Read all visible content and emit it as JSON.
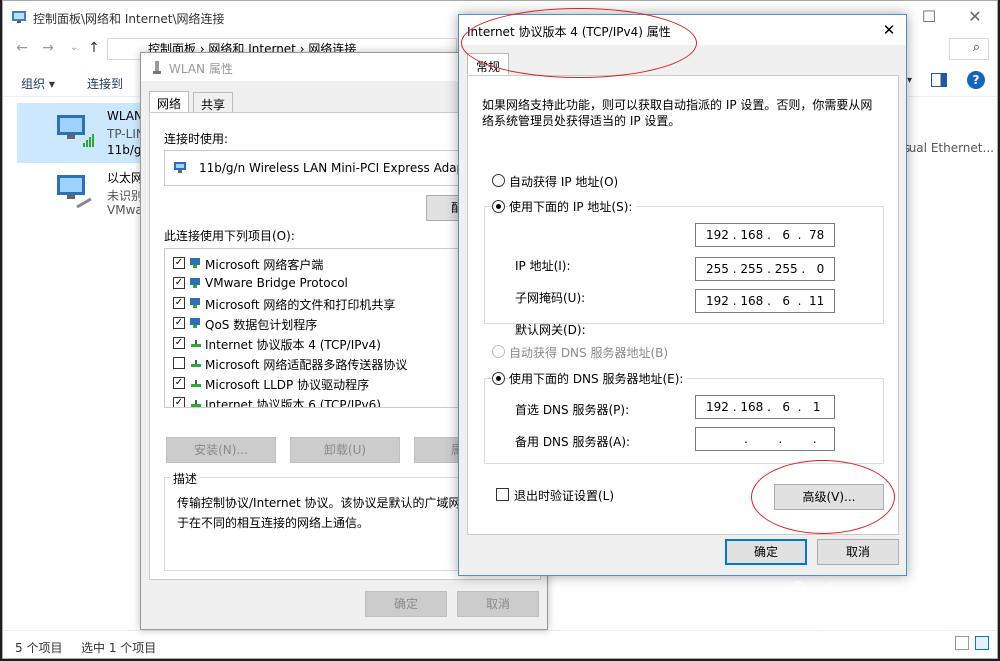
{
  "explorer": {
    "title": "控制面板\\网络和 Internet\\网络连接",
    "address": "控制面板 › 网络和 Internet › 网络连接",
    "toolbar": {
      "organize": "组织 ▾",
      "connect_to": "连接到"
    },
    "entries": [
      {
        "name": "WLAN",
        "line2": "TP-LIN",
        "line3": "11b/g/",
        "selected": true
      },
      {
        "name": "以太网",
        "line2": "未识别",
        "line3": "VMwa"
      }
    ],
    "right_partial": "tual Ethernet...",
    "status": {
      "count": "5 个项目",
      "selected": "选中 1 个项目"
    }
  },
  "wlan": {
    "title": "WLAN 属性",
    "tabs": [
      "网络",
      "共享"
    ],
    "connect_using_label": "连接时使用:",
    "adapter_name": "11b/g/n  Wireless LAN Mini-PCI Express Adap",
    "configure_partial": "配",
    "items_label": "此连接使用下列项目(O):",
    "items": [
      {
        "label": "Microsoft 网络客户端",
        "checked": true
      },
      {
        "label": "VMware Bridge Protocol",
        "checked": true
      },
      {
        "label": "Microsoft 网络的文件和打印机共享",
        "checked": true
      },
      {
        "label": "QoS 数据包计划程序",
        "checked": true
      },
      {
        "label": "Internet 协议版本 4 (TCP/IPv4)",
        "checked": true
      },
      {
        "label": "Microsoft 网络适配器多路传送器协议",
        "checked": false
      },
      {
        "label": "Microsoft LLDP 协议驱动程序",
        "checked": true
      },
      {
        "label": "Internet 协议版本 6 (TCP/IPv6)",
        "checked": true
      }
    ],
    "install_button": "安装(N)...",
    "uninstall_button": "卸载(U)",
    "properties_partial": "属",
    "description_label": "描述",
    "description_text_1": "传输控制协议/Internet 协议。该协议是默认的广域网络",
    "description_text_2": "于在不同的相互连接的网络上通信。",
    "ok_button": "确定",
    "cancel_button": "取消"
  },
  "ipv4": {
    "title": "Internet 协议版本 4 (TCP/IPv4) 属性",
    "tab": "常规",
    "intro_1": "如果网络支持此功能，则可以获取自动指派的 IP 设置。否则，你需要从网",
    "intro_2": "络系统管理员处获得适当的 IP 设置。",
    "auto_ip": "自动获得 IP 地址(O)",
    "use_ip": "使用下面的 IP 地址(S):",
    "ip_label": "IP 地址(I):",
    "ip_value": "192 . 168 .   6  .  78",
    "mask_label": "子网掩码(U):",
    "mask_value": "255 . 255 . 255 .   0",
    "gateway_label": "默认网关(D):",
    "gateway_value": "192 . 168 .   6  .  11",
    "auto_dns": "自动获得 DNS 服务器地址(B)",
    "use_dns": "使用下面的 DNS 服务器地址(E):",
    "pref_dns_label": "首选 DNS 服务器(P):",
    "pref_dns_value": "192 . 168 .   6  .   1",
    "alt_dns_label": "备用 DNS 服务器(A):",
    "alt_dns_value": "          .        .        .",
    "validate_label": "退出时验证设置(L)",
    "advanced_button": "高级(V)...",
    "ok_button": "确定",
    "cancel_button": "取消"
  },
  "colors": {
    "accent": "#0078d7",
    "annotation": "#e02020",
    "selection": "#cce8ff"
  }
}
